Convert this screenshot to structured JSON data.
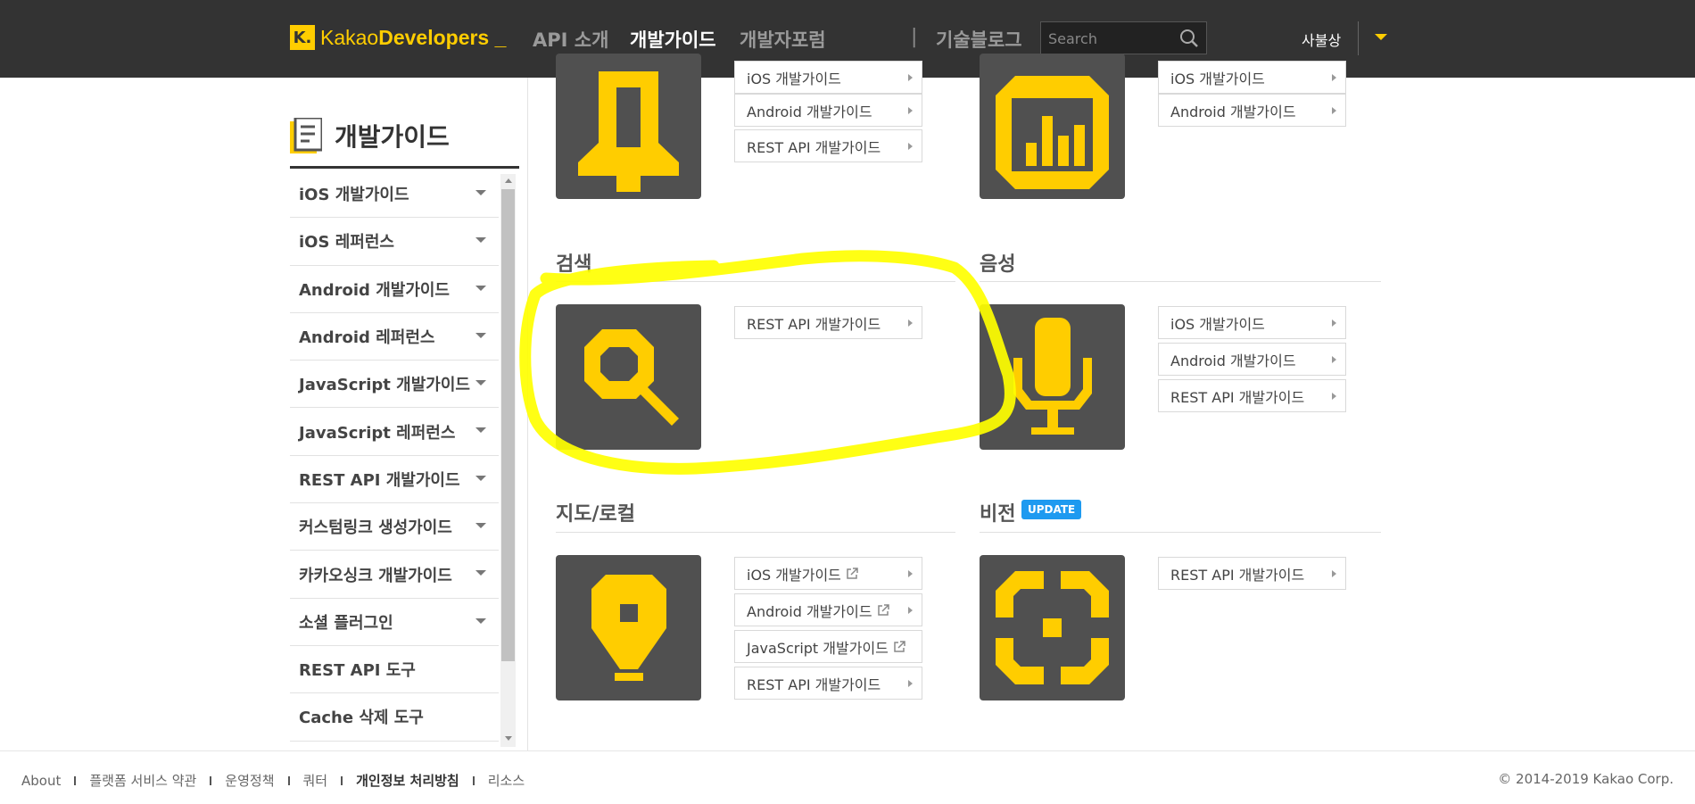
{
  "header": {
    "logo_mark": "K.",
    "logo_light": "Kakao",
    "logo_bold": "Developers",
    "logo_tail": "_",
    "nav": [
      "API 소개",
      "개발가이드",
      "개발자포럼"
    ],
    "separator": "|",
    "tech_blog": "기술블로그",
    "search_placeholder": "Search",
    "user": "사불상"
  },
  "sidebar": {
    "title": "개발가이드",
    "items": [
      {
        "label": "iOS 개발가이드",
        "expandable": true
      },
      {
        "label": "iOS 레퍼런스",
        "expandable": true
      },
      {
        "label": "Android 개발가이드",
        "expandable": true
      },
      {
        "label": "Android 레퍼런스",
        "expandable": true
      },
      {
        "label": "JavaScript 개발가이드",
        "expandable": true
      },
      {
        "label": "JavaScript 레퍼런스",
        "expandable": true
      },
      {
        "label": "REST API 개발가이드",
        "expandable": true
      },
      {
        "label": "커스텀링크 생성가이드",
        "expandable": true
      },
      {
        "label": "카카오싱크 개발가이드",
        "expandable": true
      },
      {
        "label": "소셜 플러그인",
        "expandable": true
      },
      {
        "label": "REST API 도구",
        "expandable": false
      },
      {
        "label": "Cache 삭제 도구",
        "expandable": false
      }
    ]
  },
  "main": {
    "top_left_links": [
      "iOS 개발가이드",
      "Android 개발가이드",
      "REST API 개발가이드"
    ],
    "top_right_links": [
      "iOS 개발가이드",
      "Android 개발가이드"
    ],
    "sections": {
      "search": {
        "title": "검색",
        "links": [
          "REST API 개발가이드"
        ]
      },
      "voice": {
        "title": "음성",
        "links": [
          "iOS 개발가이드",
          "Android 개발가이드",
          "REST API 개발가이드"
        ]
      },
      "map": {
        "title": "지도/로컬",
        "links": [
          "iOS 개발가이드",
          "Android 개발가이드",
          "JavaScript 개발가이드",
          "REST API 개발가이드"
        ]
      },
      "vision": {
        "title": "비전",
        "badge": "UPDATE",
        "links": [
          "REST API 개발가이드"
        ]
      }
    }
  },
  "footer": {
    "links": [
      "About",
      "플랫폼 서비스 약관",
      "운영정책",
      "쿼터",
      "개인정보 처리방침",
      "리소스"
    ],
    "copyright": "© 2014-2019 Kakao Corp."
  },
  "colors": {
    "brand_yellow": "#ffcd00",
    "topbar": "#333333",
    "tile": "#505050",
    "update_badge": "#1e9af0",
    "highlight_marker": "#ffff00"
  }
}
